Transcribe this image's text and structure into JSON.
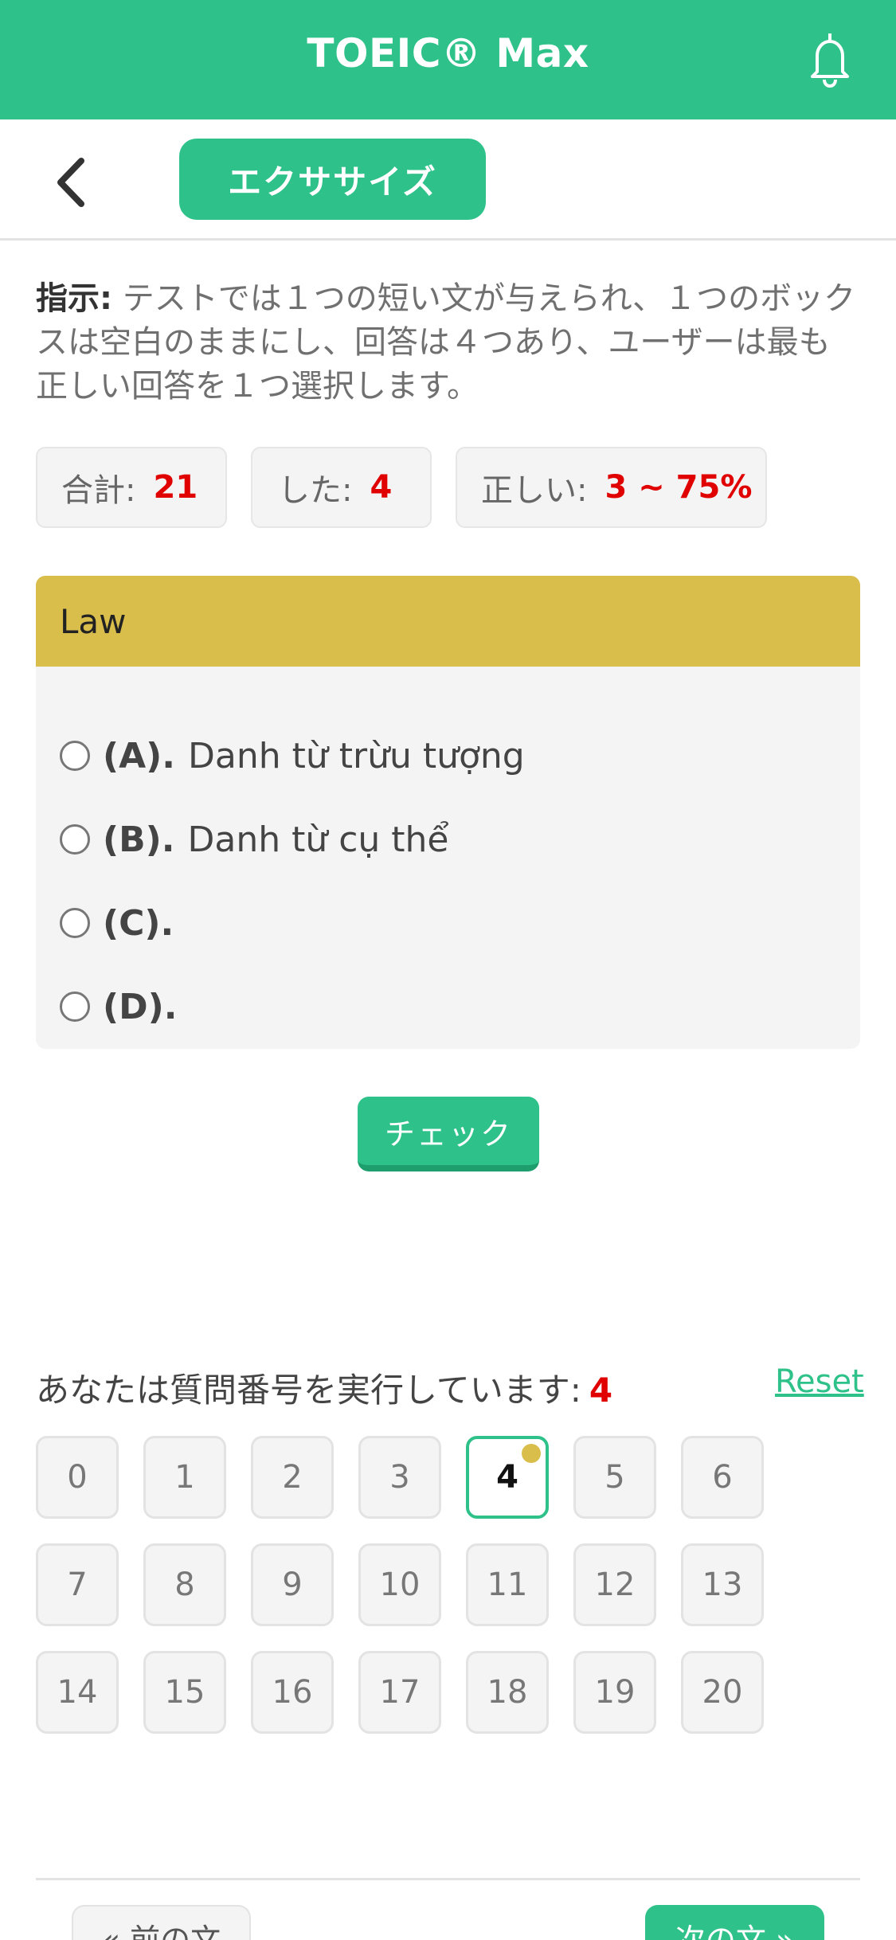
{
  "header": {
    "app_title": "TOEIC® Max",
    "bell_icon": "bell-icon",
    "bg_color": "#2ec28a"
  },
  "subheader": {
    "back_icon": "chevron-left-icon",
    "tab_label": "エクササイズ"
  },
  "instruction": {
    "label": "指示:",
    "text": " テストでは１つの短い文が与えられ、１つのボックスは空白のままにし、回答は４つあり、ユーザーは最も正しい回答を１つ選択します。"
  },
  "stats": {
    "total_label": "合計:",
    "total_value": "21",
    "done_label": "した:",
    "done_value": "4",
    "correct_label": "正しい:",
    "correct_value": "3 ~ 75%"
  },
  "question": {
    "title": "Law",
    "options": [
      {
        "letter": "(A).",
        "text": "Danh từ trừu tượng"
      },
      {
        "letter": "(B).",
        "text": "Danh từ cụ thể"
      },
      {
        "letter": "(C).",
        "text": ""
      },
      {
        "letter": "(D).",
        "text": ""
      }
    ]
  },
  "check_label": "チェック",
  "progress": {
    "label": "あなたは質問番号を実行しています:",
    "current": "4",
    "reset_label": "Reset"
  },
  "question_numbers": [
    "0",
    "1",
    "2",
    "3",
    "4",
    "5",
    "6",
    "7",
    "8",
    "9",
    "10",
    "11",
    "12",
    "13",
    "14",
    "15",
    "16",
    "17",
    "18",
    "19",
    "20"
  ],
  "nav": {
    "prev_label": "« 前の文",
    "next_label": "次の文 »"
  },
  "colors": {
    "accent": "#2ec28a",
    "question_header": "#d9be4c",
    "highlight_number": "#e00000"
  }
}
